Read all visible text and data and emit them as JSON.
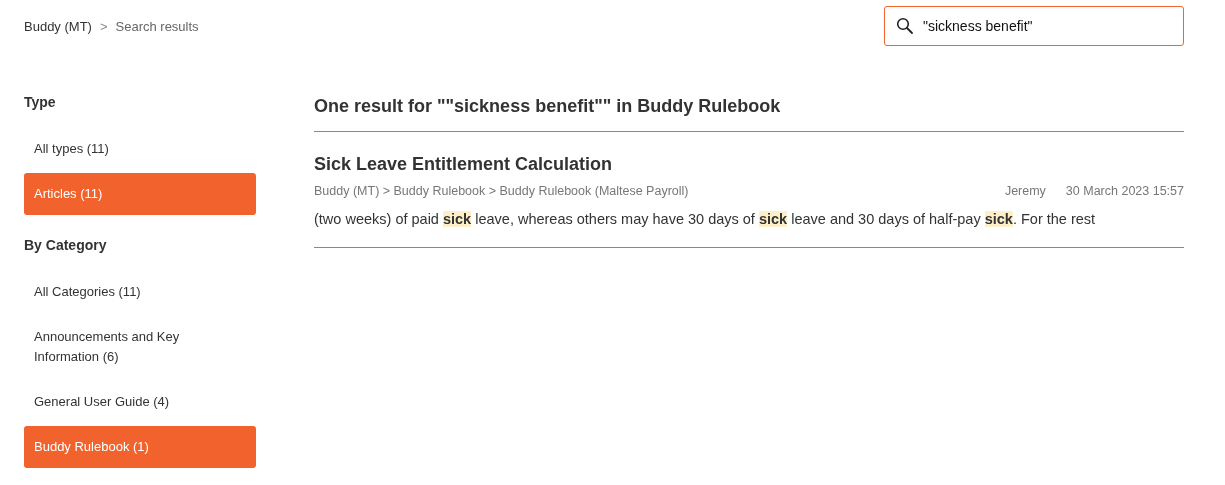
{
  "breadcrumb": {
    "items": [
      {
        "label": "Buddy (MT)",
        "kind": "link"
      },
      {
        "label": "Search results",
        "kind": "current"
      }
    ],
    "separator": ">"
  },
  "search": {
    "value": "\"sickness benefit\""
  },
  "filters": [
    {
      "heading": "Type",
      "items": [
        {
          "label": "All types (11)",
          "selected": false
        },
        {
          "label": "Articles (11)",
          "selected": true
        }
      ]
    },
    {
      "heading": "By Category",
      "items": [
        {
          "label": "All Categories (11)",
          "selected": false
        },
        {
          "label": "Announcements and Key Information (6)",
          "selected": false
        },
        {
          "label": "General User Guide (4)",
          "selected": false
        },
        {
          "label": "Buddy Rulebook (1)",
          "selected": true
        }
      ]
    }
  ],
  "results_heading": "One result for \"\"sickness benefit\"\" in Buddy Rulebook",
  "results": [
    {
      "title": "Sick Leave Entitlement Calculation",
      "path": "Buddy (MT) > Buddy Rulebook > Buddy Rulebook (Maltese Payroll)",
      "author": "Jeremy",
      "date": "30 March 2023 15:57",
      "snippet": "(two weeks) of paid **sick** leave, whereas others may have 30 days of **sick** leave and 30 days of half-pay **sick**. For the rest"
    }
  ]
}
